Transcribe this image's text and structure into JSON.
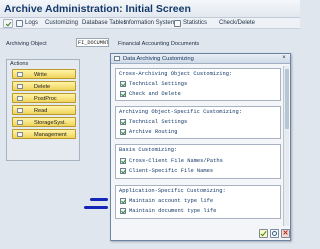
{
  "window": {
    "title": "Archive Administration: Initial Screen"
  },
  "menu": {
    "items": [
      "Logs",
      "Customizing",
      "Database Tables",
      "Information System",
      "Statistics",
      "Check/Delete"
    ]
  },
  "archiving_object": {
    "label": "Archiving Object",
    "value": "FI_DOCUMNT",
    "description": "Financial Accounting Documents"
  },
  "actions": {
    "title": "Actions",
    "buttons": [
      "Write",
      "Delete",
      "PostProc",
      "Read",
      "StorageSyst.",
      "Management"
    ]
  },
  "dialog": {
    "title": "Data Archiving Customizing",
    "groups": [
      {
        "title": "Cross-Archiving Object Customizing:",
        "items": [
          "Technical Settings",
          "Check and Delete"
        ]
      },
      {
        "title": "Archiving Object-Specific Customizing:",
        "items": [
          "Technical Settings",
          "Archive Routing"
        ]
      },
      {
        "title": "Basis Customizing:",
        "items": [
          "Cross-Client File Names/Paths",
          "Client-Specific File Names"
        ]
      },
      {
        "title": "Application-Specific Customizing:",
        "items": [
          "Maintain account type life",
          "Maintain document type life"
        ]
      }
    ]
  },
  "colors": {
    "title_blue": "#14396b",
    "action_yellow": "#efd45c",
    "annotation_blue": "#1426b8"
  },
  "icons": [
    "checkmark-icon",
    "search-icon",
    "cancel-icon",
    "folder-icon"
  ]
}
